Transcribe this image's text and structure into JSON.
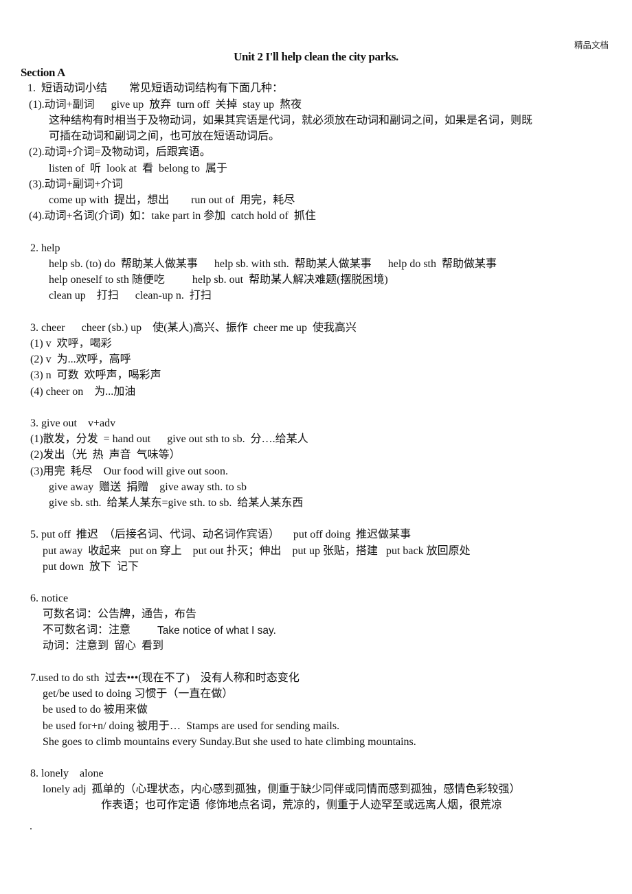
{
  "header": {
    "watermark": "精品文档"
  },
  "title": "Unit 2 I'll help clean the city parks.",
  "section": "Section A",
  "lines": [
    "1.  短语动词小结        常见短语动词结构有下面几种：",
    "(1).动词+副词      give up  放弃  turn off  关掉  stay up  熬夜",
    "这种结构有时相当于及物动词，如果其宾语是代词，就必须放在动词和副词之间，如果是名词，则既",
    "可插在动词和副词之间，也可放在短语动词后。",
    "(2).动词+介词=及物动词，后跟宾语。",
    "listen of  听  look at  看  belong to  属于",
    "(3).动词+副词+介词",
    "come up with  提出，想出        run out of  用完，耗尽",
    "(4).动词+名词(介词)  如：take part in 参加  catch hold of  抓住",
    "2. help",
    "help sb. (to) do  帮助某人做某事      help sb. with sth.  帮助某人做某事      help do sth  帮助做某事",
    "help oneself to sth 随便吃          help sb. out  帮助某人解决难题(摆脱困境)",
    "clean up    打扫      clean-up n.  打扫",
    "3. cheer      cheer (sb.) up    使(某人)高兴、振作  cheer me up  使我高兴",
    "(1) v  欢呼，喝彩",
    "(2) v  为...欢呼，高呼",
    "(3) n  可数  欢呼声，喝彩声",
    "(4) cheer on    为...加油",
    "3. give out    v+adv",
    "(1)散发，分发  = hand out      give out sth to sb.  分….给某人",
    "(2)发出（光  热  声音  气味等）",
    "(3)用完  耗尽    Our food will give out soon.",
    "give away  赠送  捐赠    give away sth. to sb",
    "give sb. sth.  给某人某东=give sth. to sb.  给某人某东西",
    "5. put off  推迟  （后接名词、代词、动名词作宾语）     put off doing  推迟做某事",
    "put away  收起来   put on 穿上    put out 扑灭；伸出    put up 张贴，搭建   put back 放回原处",
    "put down  放下  记下",
    "6. notice",
    "可数名词：公告牌，通告，布告",
    "不可数名词：注意",
    "Take notice of what I say.",
    "动词：注意到  留心  看到",
    "7.used to do sth  过去•••(现在不了)    没有人称和时态变化",
    "get/be used to doing 习惯于（一直在做）",
    "be used to do 被用来做",
    "be used for+n/ doing 被用于…  Stamps are used for sending mails.",
    "She goes to climb mountains every Sunday.But she used to hate climbing mountains.",
    "8. lonely    alone",
    "lonely adj  孤单的（心理状态，内心感到孤独，侧重于缺少同伴或同情而感到孤独，感情色彩较强）",
    "作表语；也可作定语  修饰地点名词，荒凉的，侧重于人迹罕至或远离人烟，很荒凉"
  ],
  "footer_mark": "."
}
